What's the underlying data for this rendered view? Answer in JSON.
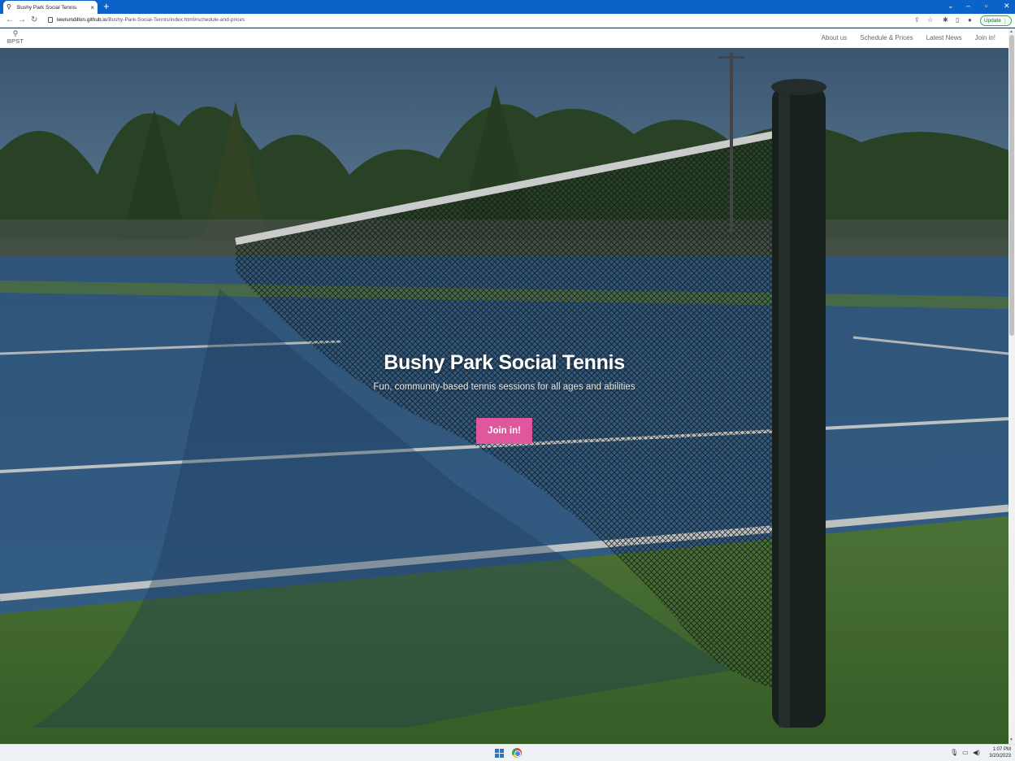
{
  "browser": {
    "tab_title": "Bushy Park Social Tennis",
    "url_host": "lewismdillon.github.io",
    "url_path": "/Bushy-Park-Social-Tennis/index.html#schedule-and-prices",
    "update_label": "Update"
  },
  "site": {
    "brand": "BPST",
    "nav": [
      "About us",
      "Schedule & Prices",
      "Latest News",
      "Join in!"
    ],
    "hero": {
      "title": "Bushy Park Social Tennis",
      "subtitle": "Fun, community-based tennis sessions for all ages and abilities",
      "cta_label": "Join in!"
    },
    "accent_color": "#e0579d"
  },
  "taskbar": {
    "time": "1:07 PM",
    "date": "3/20/2023"
  }
}
